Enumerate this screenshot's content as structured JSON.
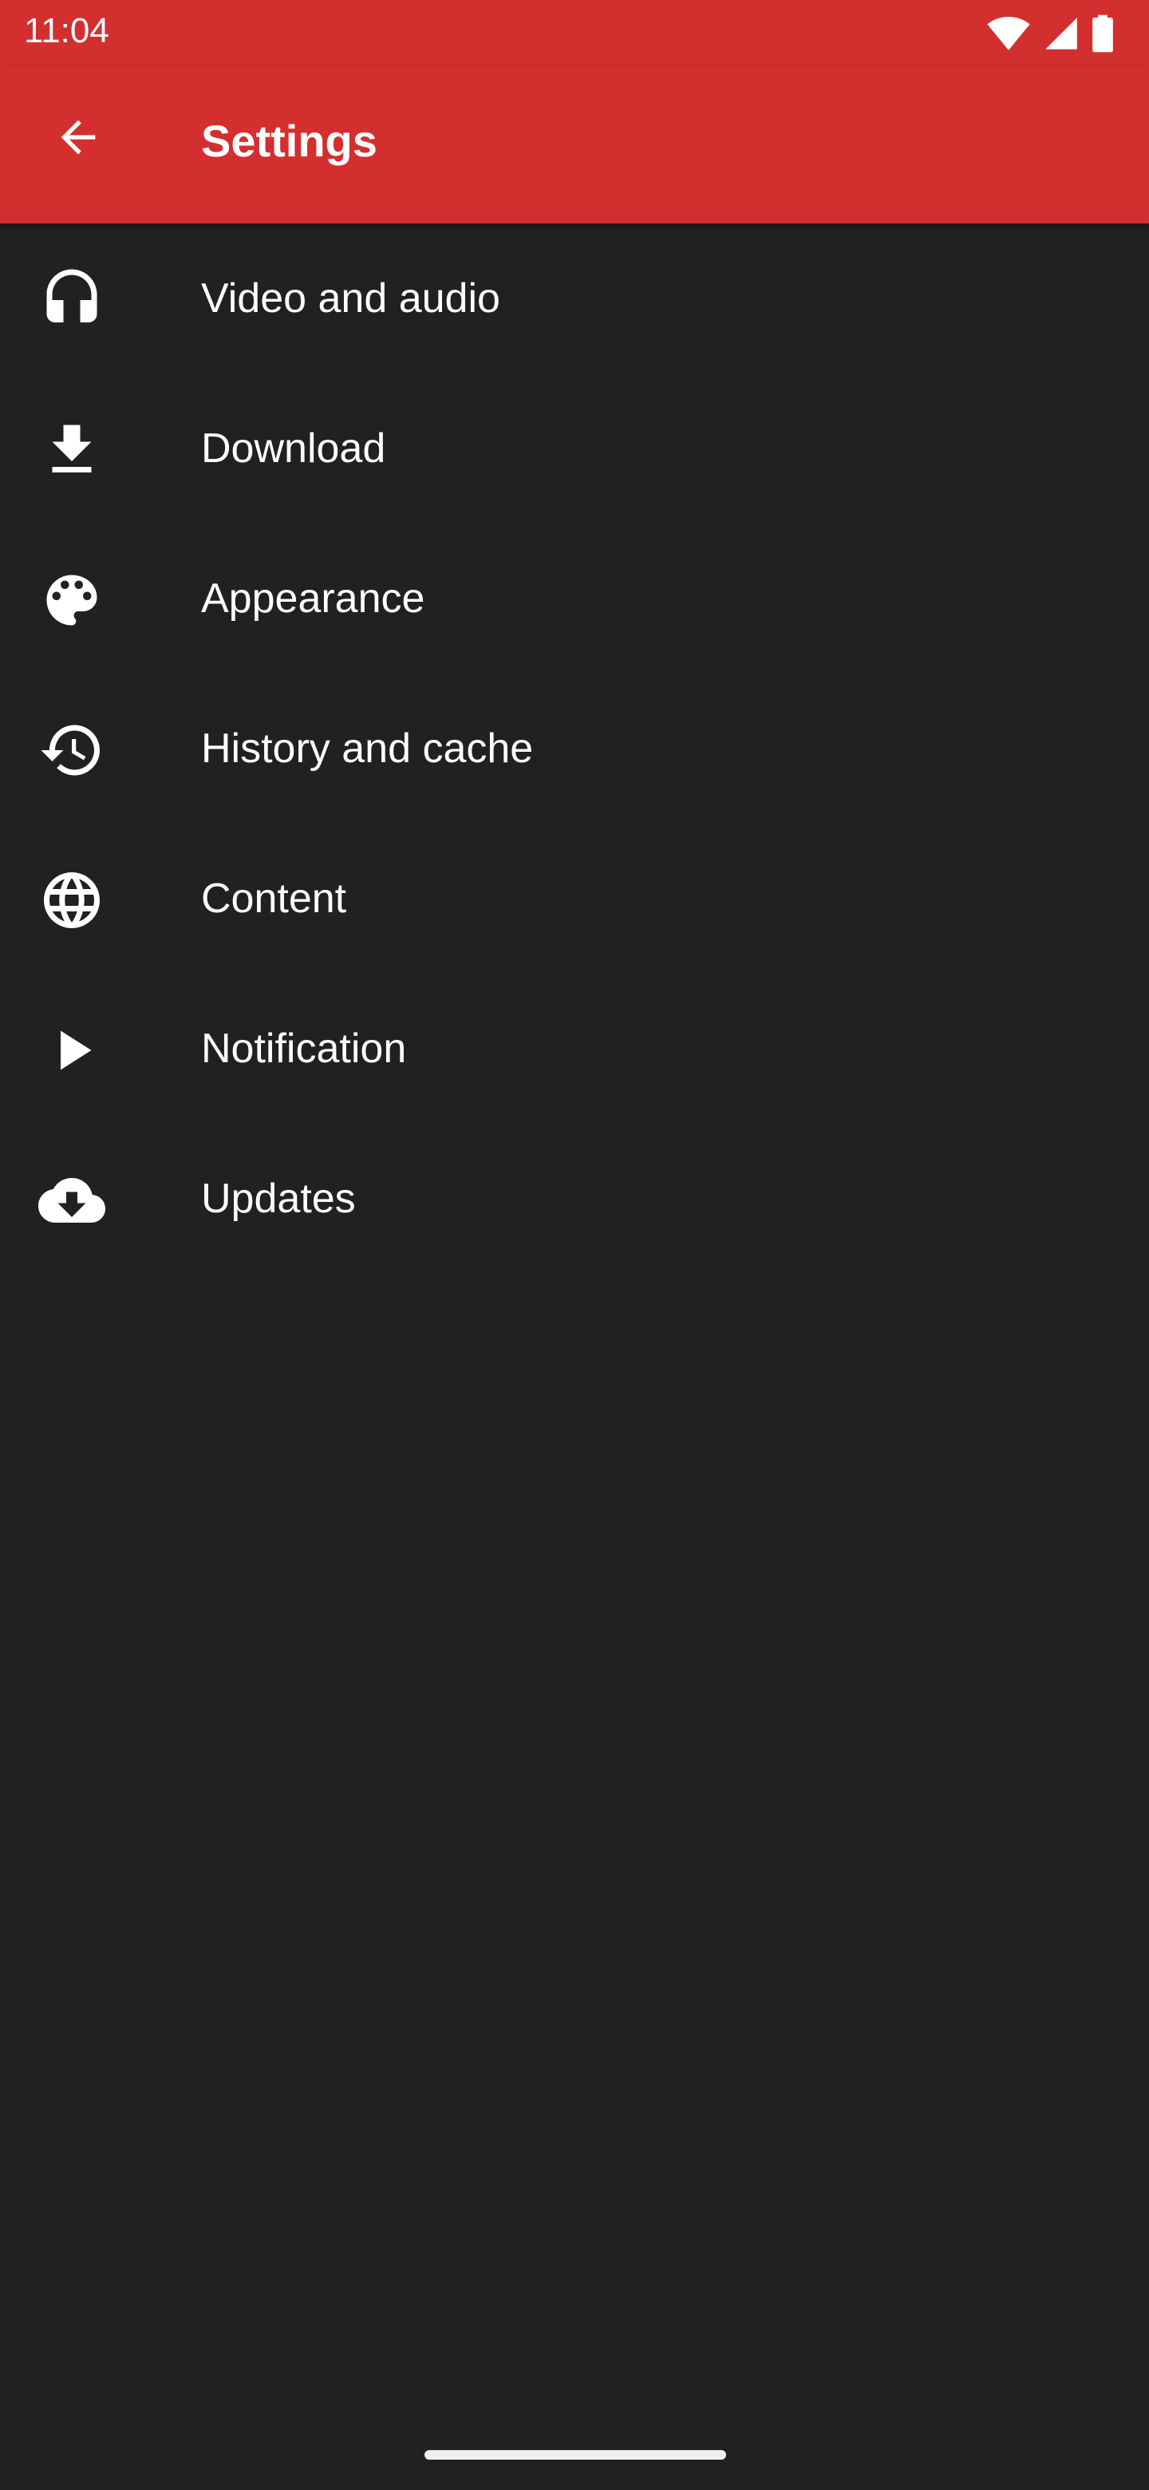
{
  "status_bar": {
    "time": "11:04",
    "icons": [
      "wifi-icon",
      "cell-signal-icon",
      "battery-icon"
    ]
  },
  "toolbar": {
    "title": "Settings",
    "back_icon": "arrow-back-icon"
  },
  "items": [
    {
      "label": "Video and audio",
      "icon": "headphones-icon"
    },
    {
      "label": "Download",
      "icon": "download-icon"
    },
    {
      "label": "Appearance",
      "icon": "palette-icon"
    },
    {
      "label": "History and cache",
      "icon": "history-icon"
    },
    {
      "label": "Content",
      "icon": "globe-icon"
    },
    {
      "label": "Notification",
      "icon": "play-icon"
    },
    {
      "label": "Updates",
      "icon": "cloud-download-icon"
    }
  ],
  "colors": {
    "accent": "#D32F2F",
    "background": "#212121",
    "text": "#FFFFFF"
  }
}
